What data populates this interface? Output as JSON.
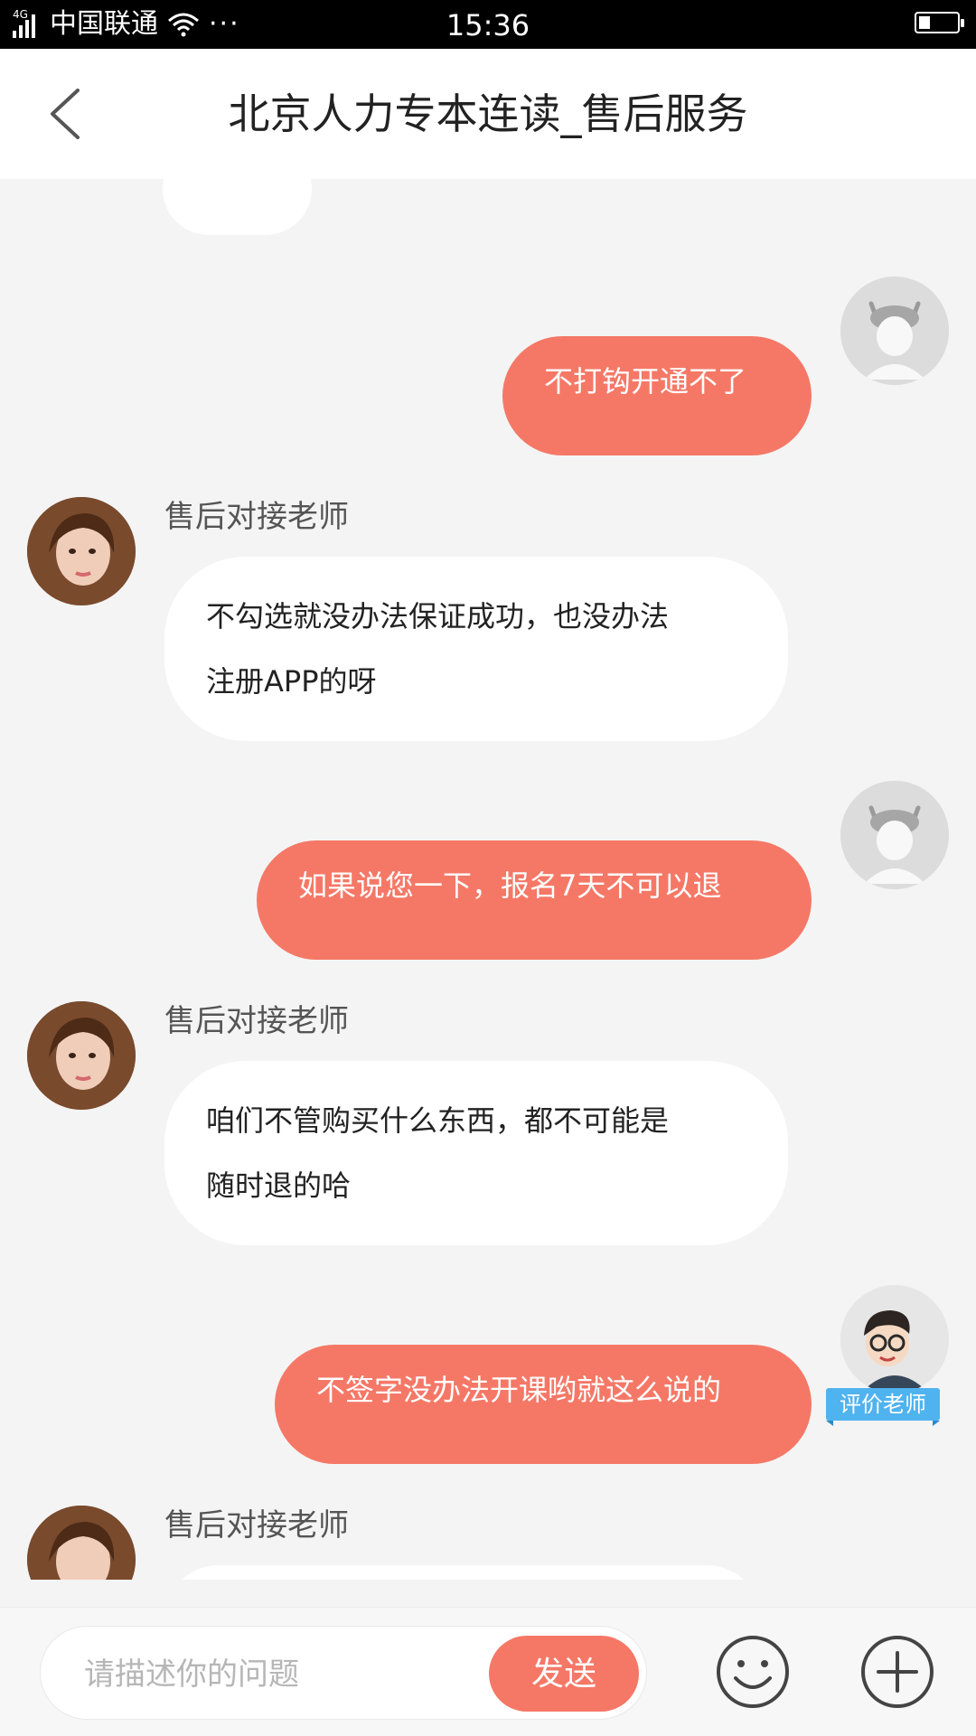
{
  "status_bar": {
    "network_type": "4G",
    "carrier": "中国联通",
    "more_dots": "···",
    "time": "15:36",
    "battery_level": 0.2
  },
  "header": {
    "title": "北京人力专本连读_售后服务",
    "back_icon": "chevron-left-icon"
  },
  "messages": [
    {
      "from": "user",
      "text": "不打钩开通不了",
      "avatar": "default-user-avatar"
    },
    {
      "from": "agent",
      "sender": "售后对接老师",
      "lines": [
        "不勾选就没办法保证成功，也没办法",
        "注册APP的呀"
      ],
      "avatar": "agent-photo-avatar"
    },
    {
      "from": "user",
      "text": "如果说您一下，报名7天不可以退",
      "avatar": "default-user-avatar"
    },
    {
      "from": "agent",
      "sender": "售后对接老师",
      "lines": [
        "咱们不管购买什么东西，都不可能是",
        "随时退的哈"
      ],
      "avatar": "agent-photo-avatar"
    },
    {
      "from": "user",
      "text": "不签字没办法开课哟就这么说的",
      "avatar": "teacher-cartoon-avatar",
      "badge": "评价老师"
    },
    {
      "from": "agent",
      "sender": "售后对接老师",
      "avatar": "agent-photo-avatar"
    }
  ],
  "input_bar": {
    "placeholder": "请描述你的问题",
    "value": "",
    "send_label": "发送",
    "emoji_icon": "smiley-icon",
    "plus_icon": "plus-circle-icon"
  },
  "colors": {
    "accent": "#f57867",
    "background": "#f4f4f4",
    "badge": "#4fb3ef"
  }
}
